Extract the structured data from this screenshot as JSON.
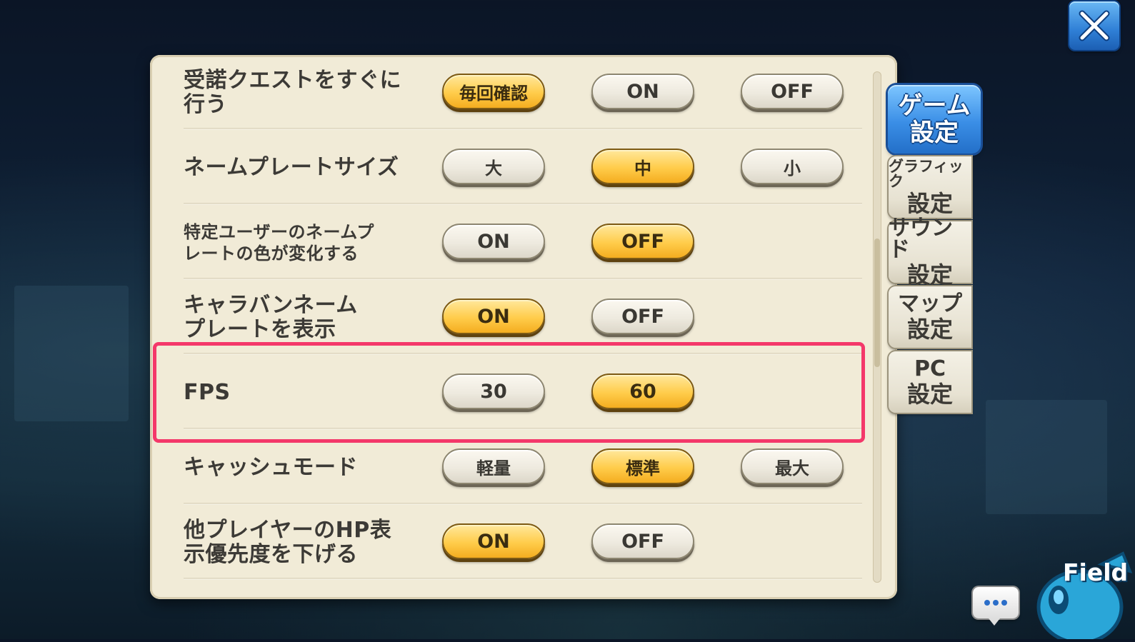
{
  "settings": [
    {
      "label": "受諾クエストをすぐに\n行う",
      "options": [
        "毎回確認",
        "ON",
        "OFF"
      ],
      "selected": 0
    },
    {
      "label": "ネームプレートサイズ",
      "options": [
        "大",
        "中",
        "小"
      ],
      "selected": 1
    },
    {
      "label": "特定ユーザーのネームプ\nレートの色が変化する",
      "options": [
        "ON",
        "OFF"
      ],
      "selected": 1
    },
    {
      "label": "キャラバンネーム\nプレートを表示",
      "options": [
        "ON",
        "OFF"
      ],
      "selected": 0
    },
    {
      "label": "FPS",
      "options": [
        "30",
        "60"
      ],
      "selected": 1
    },
    {
      "label": "キャッシュモード",
      "options": [
        "軽量",
        "標準",
        "最大"
      ],
      "selected": 1
    },
    {
      "label": "他プレイヤーのHP表\n示優先度を下げる",
      "options": [
        "ON",
        "OFF"
      ],
      "selected": 0
    }
  ],
  "tabs": [
    {
      "line1": "ゲーム",
      "line2": "設定",
      "active": true
    },
    {
      "line1": "グラフィック",
      "line2": "設定",
      "active": false
    },
    {
      "line1": "サウンド",
      "line2": "設定",
      "active": false
    },
    {
      "line1": "マップ",
      "line2": "設定",
      "active": false
    },
    {
      "line1": "PC",
      "line2": "設定",
      "active": false
    }
  ],
  "field_label": "Field",
  "scroll_fraction": 0.33,
  "colors": {
    "selected": "#ffcc4a",
    "highlight_border": "#f4386a",
    "tab_active": "#3a8ee6"
  },
  "icons": {
    "close": "close-icon",
    "chat": "chat-bubble-icon",
    "field": "field-badge-icon"
  }
}
